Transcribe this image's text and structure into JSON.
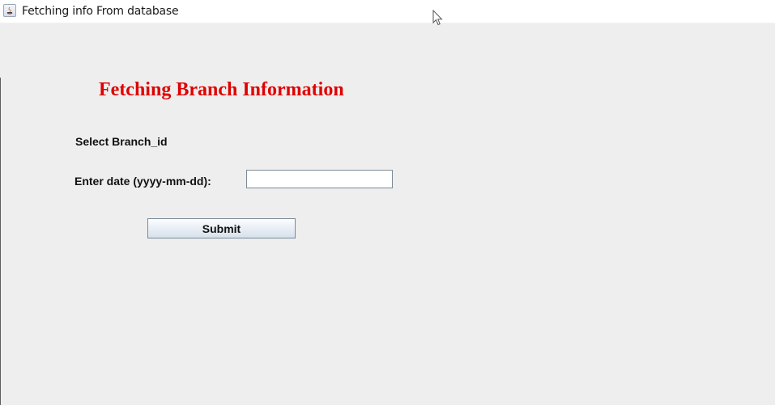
{
  "window": {
    "title": "Fetching info From database",
    "icon": "java-icon"
  },
  "form": {
    "heading": "Fetching Branch Information",
    "branch_label": "Select Branch_id",
    "date_label": "Enter date (yyyy-mm-dd):",
    "date_value": "",
    "submit_label": "Submit"
  },
  "colors": {
    "heading": "#e00000",
    "background": "#eeeeee"
  }
}
